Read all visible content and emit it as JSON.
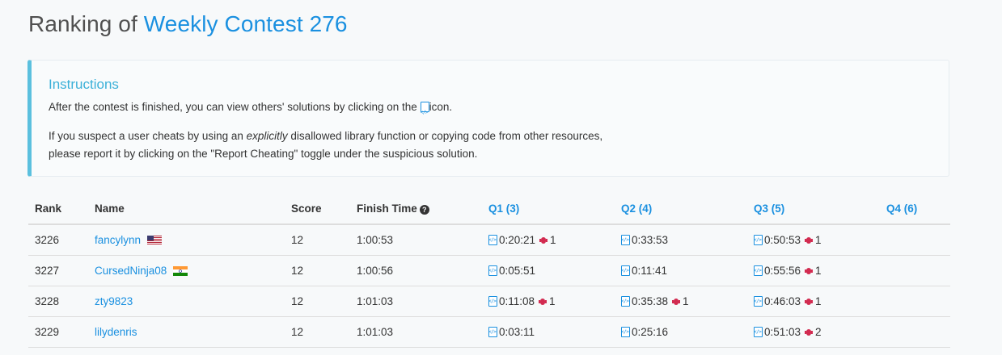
{
  "heading": {
    "prefix": "Ranking of ",
    "contest": "Weekly Contest 276"
  },
  "instructions": {
    "title": "Instructions",
    "p1_before": "After the contest is finished, you can view others' solutions by clicking on the",
    "p1_after": "icon.",
    "p2_before": "If you suspect a user cheats by using an ",
    "p2_emph": "explicitly",
    "p2_after": " disallowed library function or copying code from other resources,",
    "p2_line2": "please report it by clicking on the \"Report Cheating\" toggle under the suspicious solution."
  },
  "table": {
    "headers": {
      "rank": "Rank",
      "name": "Name",
      "score": "Score",
      "finish": "Finish Time",
      "info_icon": "?",
      "q1": "Q1 (3)",
      "q2": "Q2 (4)",
      "q3": "Q3 (5)",
      "q4": "Q4 (6)"
    },
    "rows": [
      {
        "rank": "3226",
        "name": "fancylynn",
        "flag": "us",
        "score": "12",
        "finish": "1:00:53",
        "q1": {
          "time": "0:20:21",
          "bugs": "1"
        },
        "q2": {
          "time": "0:33:53",
          "bugs": ""
        },
        "q3": {
          "time": "0:50:53",
          "bugs": "1"
        }
      },
      {
        "rank": "3227",
        "name": "CursedNinja08",
        "flag": "in",
        "score": "12",
        "finish": "1:00:56",
        "q1": {
          "time": "0:05:51",
          "bugs": ""
        },
        "q2": {
          "time": "0:11:41",
          "bugs": ""
        },
        "q3": {
          "time": "0:55:56",
          "bugs": "1"
        }
      },
      {
        "rank": "3228",
        "name": "zty9823",
        "flag": "",
        "score": "12",
        "finish": "1:01:03",
        "q1": {
          "time": "0:11:08",
          "bugs": "1"
        },
        "q2": {
          "time": "0:35:38",
          "bugs": "1"
        },
        "q3": {
          "time": "0:46:03",
          "bugs": "1"
        }
      },
      {
        "rank": "3229",
        "name": "lilydenris",
        "flag": "",
        "score": "12",
        "finish": "1:01:03",
        "q1": {
          "time": "0:03:11",
          "bugs": ""
        },
        "q2": {
          "time": "0:25:16",
          "bugs": ""
        },
        "q3": {
          "time": "0:51:03",
          "bugs": "2"
        }
      }
    ]
  },
  "colors": {
    "link": "#1a90e0",
    "accent": "#5bc0de",
    "bug": "#d22b50"
  },
  "icons": {
    "solution": "code-file-icon",
    "bug": "bug-icon",
    "info": "question-circle-icon"
  }
}
